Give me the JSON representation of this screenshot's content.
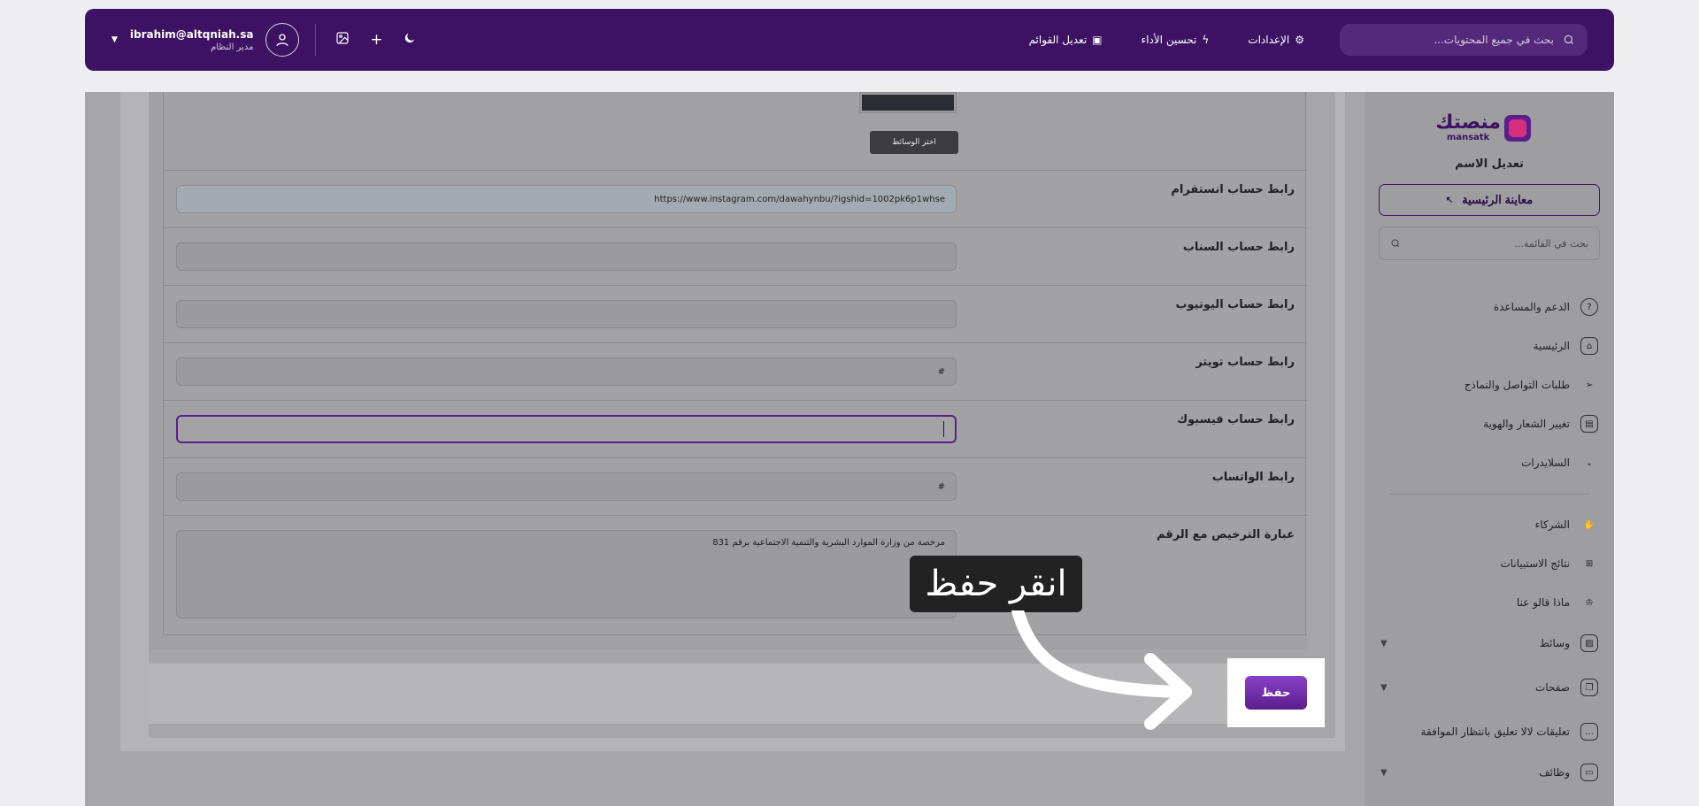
{
  "topbar": {
    "search_placeholder": "بحث في جميع المحتويات...",
    "nav": [
      {
        "label": "الإعدادات",
        "icon": "gear-icon"
      },
      {
        "label": "تحسين الأداء",
        "icon": "bolt-icon"
      },
      {
        "label": "تعديل القوائم",
        "icon": "menu-layout-icon"
      }
    ],
    "user": {
      "email": "ibrahim@altqniah.sa",
      "role": "مدير النظام"
    }
  },
  "sidebar": {
    "logo_ar": "منصتك",
    "logo_en": "mansatk",
    "site_name": "تعديل الاسم",
    "preview_label": "معاينة الرئيسية",
    "search_placeholder": "بحث في القائمة...",
    "items": [
      {
        "label": "الدعم والمساعدة",
        "icon": "help-circle-icon"
      },
      {
        "label": "الرئيسية",
        "icon": "home-icon"
      },
      {
        "label": "طلبات التواصل والنماذج",
        "icon": "send-icon"
      },
      {
        "label": "تغيير الشعار والهوية",
        "icon": "layout-icon"
      },
      {
        "label": "السلايدرات",
        "icon": "chevron-down-icon"
      },
      {
        "label": "الشركاء",
        "icon": "handshake-icon"
      },
      {
        "label": "نتائج الاستبيانات",
        "icon": "grid-icon"
      },
      {
        "label": "ماذا قالو عنا",
        "icon": "crown-icon"
      },
      {
        "label": "وسائط",
        "icon": "image-icon"
      },
      {
        "label": "صفحات",
        "icon": "pages-icon"
      },
      {
        "label": "تعليقات لالا تعليق بانتظار الموافقة",
        "icon": "comment-icon"
      },
      {
        "label": "وظائف",
        "icon": "briefcase-icon"
      }
    ]
  },
  "form": {
    "media_button": "اختر الوسائط",
    "rows": [
      {
        "label": "رابط حساب انستقرام",
        "value": "https://www.instagram.com/dawahynbu/?igshid=1002pk6p1whse"
      },
      {
        "label": "رابط حساب السناب",
        "value": ""
      },
      {
        "label": "رابط حساب اليوتيوب",
        "value": ""
      },
      {
        "label": "رابط حساب تويتر",
        "value": "#"
      },
      {
        "label": "رابط حساب فيسبوك",
        "value": ""
      },
      {
        "label": "رابط الواتساب",
        "value": "#"
      },
      {
        "label": "عبارة الترخيص مع الرقم",
        "value": "مرخصة من وزارة الموارد البشرية والتنمية الاجتماعية برقم 831"
      }
    ]
  },
  "save_label": "حفظ",
  "tooltip": "انقر حفظ"
}
